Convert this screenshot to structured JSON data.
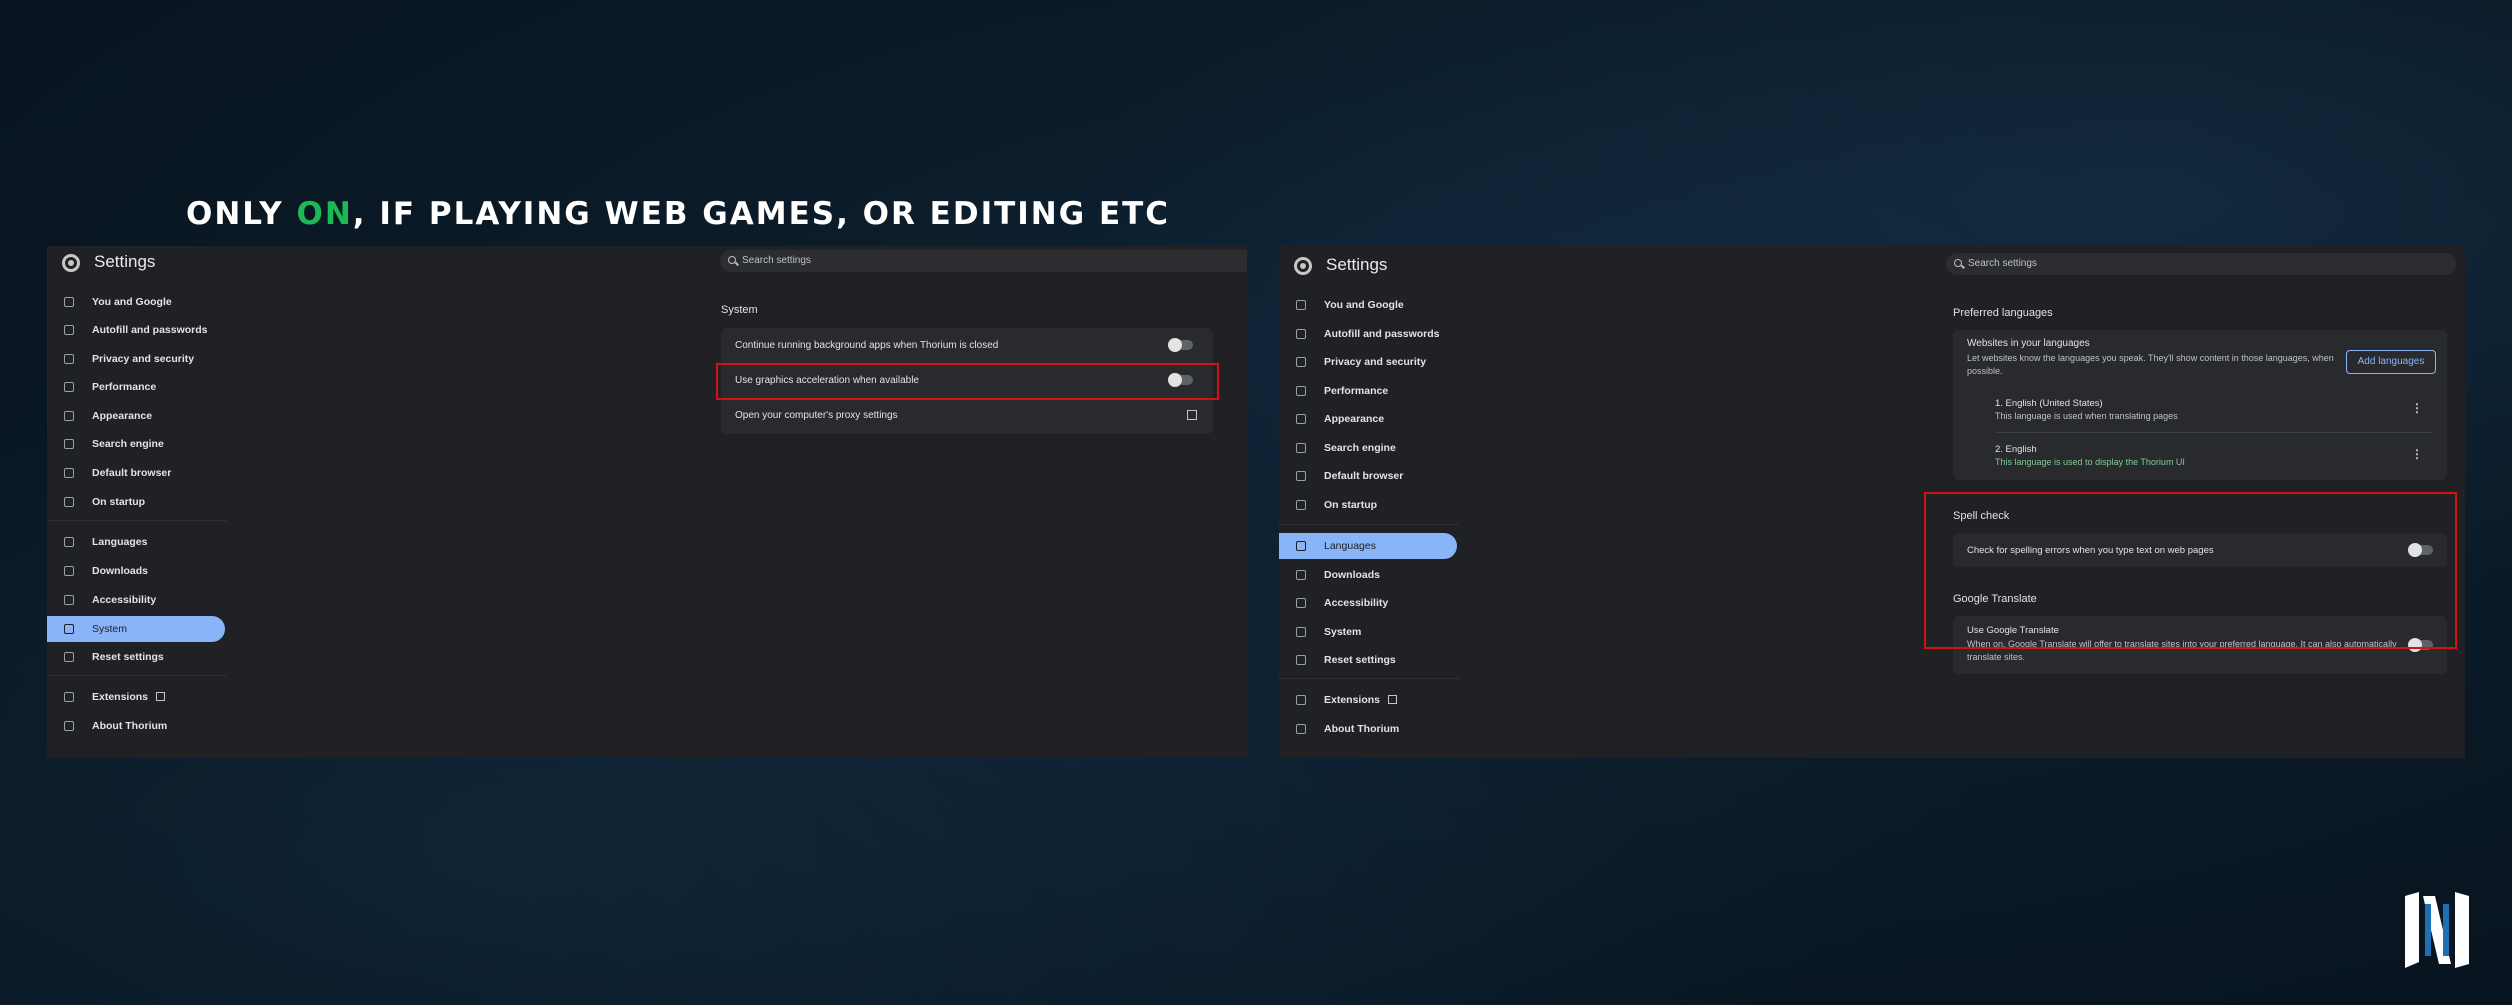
{
  "headline": {
    "before": "ONLY ",
    "accent": "ON",
    "after": ", IF PLAYING WEB GAMES, OR EDITING ETC",
    "accent_color": "#1db954"
  },
  "left_window": {
    "title": "Settings",
    "search_placeholder": "Search settings",
    "nav": [
      {
        "label": "You and Google",
        "icon": "person-icon"
      },
      {
        "label": "Autofill and passwords",
        "icon": "key-icon"
      },
      {
        "label": "Privacy and security",
        "icon": "shield-icon"
      },
      {
        "label": "Performance",
        "icon": "speedometer-icon"
      },
      {
        "label": "Appearance",
        "icon": "palette-icon"
      },
      {
        "label": "Search engine",
        "icon": "search-icon"
      },
      {
        "label": "Default browser",
        "icon": "browser-icon"
      },
      {
        "label": "On startup",
        "icon": "power-icon"
      },
      {
        "label": "Languages",
        "icon": "translate-icon"
      },
      {
        "label": "Downloads",
        "icon": "download-icon"
      },
      {
        "label": "Accessibility",
        "icon": "accessibility-icon"
      },
      {
        "label": "System",
        "icon": "wrench-icon",
        "active": true
      },
      {
        "label": "Reset settings",
        "icon": "reset-icon"
      },
      {
        "label": "Extensions",
        "icon": "puzzle-icon"
      },
      {
        "label": "About Thorium",
        "icon": "thorium-icon"
      }
    ],
    "section": "System",
    "rows": [
      {
        "label": "Continue running background apps when Thorium is closed",
        "toggle": "off"
      },
      {
        "label": "Use graphics acceleration when available",
        "toggle": "off",
        "highlighted": true
      },
      {
        "label": "Open your computer's proxy settings",
        "action": "open-external-icon"
      }
    ]
  },
  "right_window": {
    "title": "Settings",
    "search_placeholder": "Search settings",
    "nav": [
      {
        "label": "You and Google"
      },
      {
        "label": "Autofill and passwords"
      },
      {
        "label": "Privacy and security"
      },
      {
        "label": "Performance"
      },
      {
        "label": "Appearance"
      },
      {
        "label": "Search engine"
      },
      {
        "label": "Default browser"
      },
      {
        "label": "On startup"
      },
      {
        "label": "Languages",
        "active": true
      },
      {
        "label": "Downloads"
      },
      {
        "label": "Accessibility"
      },
      {
        "label": "System"
      },
      {
        "label": "Reset settings"
      },
      {
        "label": "Extensions"
      },
      {
        "label": "About Thorium"
      }
    ],
    "preferred": {
      "heading": "Preferred languages",
      "title": "Websites in your languages",
      "desc": "Let websites know the languages you speak. They'll show content in those languages, when possible.",
      "add_button": "Add languages",
      "languages": [
        {
          "name": "1. English (United States)",
          "note": "This language is used when translating pages"
        },
        {
          "name": "2. English",
          "note": "This language is used to display the Thorium UI"
        }
      ]
    },
    "spell": {
      "heading": "Spell check",
      "label": "Check for spelling errors when you type text on web pages",
      "toggle": "off"
    },
    "translate": {
      "heading": "Google Translate",
      "label": "Use Google Translate",
      "desc": "When on, Google Translate will offer to translate sites into your preferred language. It can also automatically translate sites.",
      "toggle": "off"
    }
  },
  "colors": {
    "highlight": "#d31212",
    "active_nav": "#8ab4f8",
    "panel": "#202124",
    "card": "#292a2d"
  }
}
